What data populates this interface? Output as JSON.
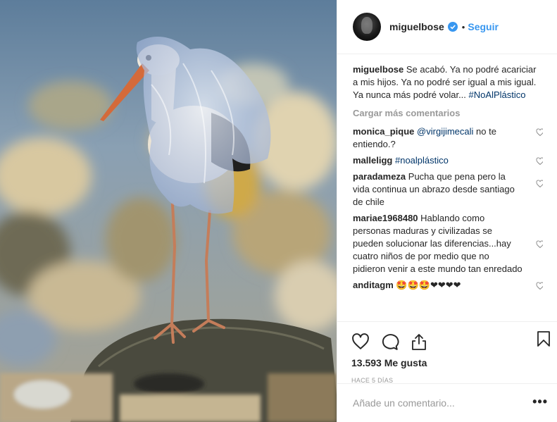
{
  "post": {
    "username": "miguelbose",
    "follow_label": "Seguir",
    "separator": "•",
    "caption_text": "Se acabó. Ya no podré acariciar a mis hijos. Ya no podré ser igual a mis igual. Ya nunca más podré volar...",
    "caption_hashtag": "#NoAlPlástico",
    "load_more_label": "Cargar más comentarios",
    "likes_text": "13.593 Me gusta",
    "time_text": "HACE 5 DÍAS",
    "add_comment_placeholder": "Añade un comentario...",
    "options_label": "•••"
  },
  "comments": [
    {
      "user": "monica_pique",
      "mention": "@virgijimecali",
      "text": " no te entiendo.?"
    },
    {
      "user": "malleligg",
      "hashtag": "#noalplástico"
    },
    {
      "user": "paradameza",
      "text": "Pucha que pena pero la vida continua un abrazo desde santiago de chile"
    },
    {
      "user": "mariae1968480",
      "text": "Hablando como personas maduras y civilizadas se pueden solucionar las diferencias...hay cuatro niños de por medio que no pidieron venir a este mundo tan enredado"
    },
    {
      "user": "anditagm",
      "text": "🤩🤩🤩❤❤❤❤"
    }
  ],
  "icons": {
    "verified": "verified-badge-icon",
    "like": "heart-icon",
    "comment": "comment-bubble-icon",
    "share": "share-icon",
    "save": "bookmark-icon",
    "comment_like": "small-heart-icon"
  },
  "colors": {
    "link_blue": "#3897f0",
    "hashtag": "#003569",
    "muted": "#999999",
    "text": "#262626"
  }
}
